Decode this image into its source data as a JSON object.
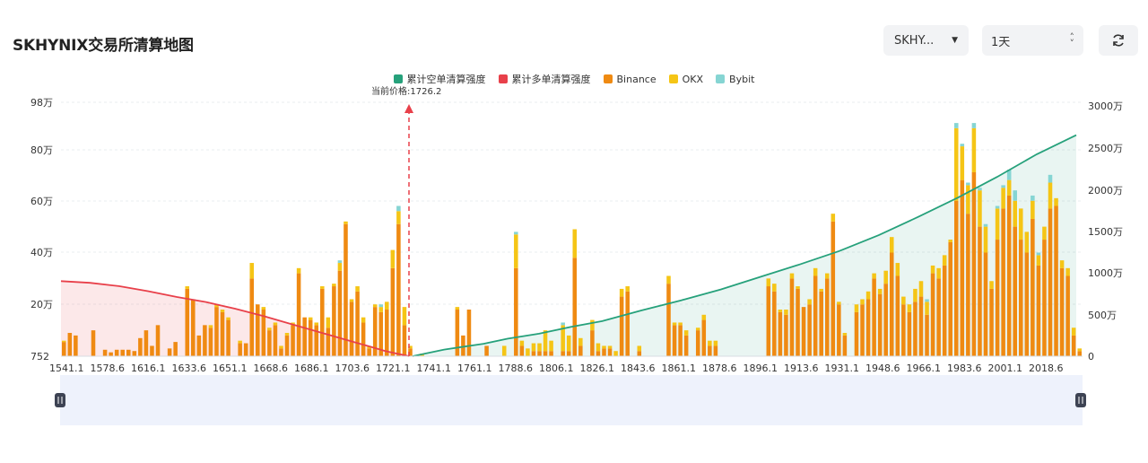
{
  "header": {
    "title": "SKHYNIX交易所清算地图",
    "symbol_select": "SKHY...",
    "interval_select": "1天"
  },
  "colors": {
    "short_cumulative": "#26a17b",
    "long_cumulative": "#e8404a",
    "binance": "#ef8a12",
    "okx": "#f5c516",
    "bybit": "#86d5d3"
  },
  "chart_data": {
    "type": "bar",
    "legend": [
      "累计空单清算强度",
      "累计多单清算强度",
      "Binance",
      "OKX",
      "Bybit"
    ],
    "current_price_label": "当前价格:1726.2",
    "current_price": 1726.2,
    "x_ticks": [
      "1541.1",
      "1578.6",
      "1616.1",
      "1633.6",
      "1651.1",
      "1668.6",
      "1686.1",
      "1703.6",
      "1721.1",
      "1741.1",
      "1761.1",
      "1788.6",
      "1806.1",
      "1826.1",
      "1843.6",
      "1861.1",
      "1878.6",
      "1896.1",
      "1913.6",
      "1931.1",
      "1948.6",
      "1966.1",
      "1983.6",
      "2001.1",
      "2018.6"
    ],
    "y_left_ticks": [
      "752",
      "20万",
      "40万",
      "60万",
      "80万",
      "98万"
    ],
    "y_left_range": [
      752,
      980000
    ],
    "y_right_ticks": [
      "0",
      "500万",
      "1000万",
      "1500万",
      "2000万",
      "2500万",
      "3000万"
    ],
    "y_right_range": [
      0,
      30000000
    ],
    "bars": [
      [
        5.5,
        0.5,
        0
      ],
      [
        9,
        0,
        0
      ],
      [
        8,
        0,
        0
      ],
      [
        0,
        0,
        0
      ],
      [
        0,
        0,
        0
      ],
      [
        10,
        0,
        0
      ],
      [
        0,
        0,
        0
      ],
      [
        2.5,
        0,
        0
      ],
      [
        1.5,
        0,
        0
      ],
      [
        2.5,
        0,
        0
      ],
      [
        2.5,
        0,
        0
      ],
      [
        2.5,
        0,
        0
      ],
      [
        2,
        0,
        0
      ],
      [
        7,
        0,
        0
      ],
      [
        10,
        0,
        0
      ],
      [
        4,
        0,
        0
      ],
      [
        12,
        0,
        0
      ],
      [
        0,
        0,
        0
      ],
      [
        3,
        0,
        0
      ],
      [
        5.5,
        0,
        0
      ],
      [
        0,
        0,
        0
      ],
      [
        26,
        1,
        0
      ],
      [
        22,
        0,
        0
      ],
      [
        8,
        0,
        0
      ],
      [
        12,
        0,
        0
      ],
      [
        11,
        1,
        0
      ],
      [
        19,
        1,
        0
      ],
      [
        17,
        1,
        0
      ],
      [
        14,
        1,
        0
      ],
      [
        0,
        0,
        0
      ],
      [
        5,
        1,
        0
      ],
      [
        5,
        0,
        0
      ],
      [
        30,
        6,
        0
      ],
      [
        20,
        0,
        0
      ],
      [
        18,
        1,
        0
      ],
      [
        10,
        1,
        0
      ],
      [
        12,
        1,
        0
      ],
      [
        3,
        1,
        0
      ],
      [
        8,
        1,
        0
      ],
      [
        12,
        1,
        0
      ],
      [
        32,
        2,
        0
      ],
      [
        15,
        0,
        0
      ],
      [
        14,
        1,
        0
      ],
      [
        12,
        1,
        0
      ],
      [
        26,
        1,
        0
      ],
      [
        11,
        4,
        0
      ],
      [
        27,
        1,
        0
      ],
      [
        33,
        3,
        1
      ],
      [
        51,
        1,
        0
      ],
      [
        21,
        1,
        0
      ],
      [
        25,
        2,
        0
      ],
      [
        13,
        2,
        0
      ],
      [
        3,
        1,
        0
      ],
      [
        19,
        1,
        0
      ],
      [
        17,
        2,
        1
      ],
      [
        18,
        3,
        0
      ],
      [
        34,
        7,
        0
      ],
      [
        51,
        5,
        2
      ],
      [
        12,
        7,
        0
      ],
      [
        3,
        1,
        0
      ],
      [
        0,
        0,
        0
      ],
      [
        0,
        1,
        0
      ],
      [
        0,
        0,
        0
      ],
      [
        0,
        0,
        0
      ],
      [
        0,
        0,
        0
      ],
      [
        0,
        0,
        0
      ],
      [
        0,
        0,
        0
      ],
      [
        18,
        1,
        0
      ],
      [
        8,
        0,
        0
      ],
      [
        18,
        0,
        0
      ],
      [
        0,
        0,
        0
      ],
      [
        0,
        0,
        0
      ],
      [
        4,
        0,
        0
      ],
      [
        0,
        0,
        0
      ],
      [
        0,
        0,
        0
      ],
      [
        0,
        4,
        0
      ],
      [
        0,
        0,
        0
      ],
      [
        34,
        13,
        1
      ],
      [
        4,
        2,
        0
      ],
      [
        0,
        3,
        0
      ],
      [
        2,
        3,
        0
      ],
      [
        2,
        3,
        0
      ],
      [
        2,
        8,
        0
      ],
      [
        2,
        4,
        0
      ],
      [
        0,
        0,
        0
      ],
      [
        2,
        10,
        1
      ],
      [
        2,
        6,
        0
      ],
      [
        38,
        11,
        0
      ],
      [
        4,
        3,
        0
      ],
      [
        0,
        0,
        0
      ],
      [
        10,
        4,
        0
      ],
      [
        2,
        3,
        0
      ],
      [
        3,
        1,
        0
      ],
      [
        3,
        1,
        0
      ],
      [
        0,
        2,
        0
      ],
      [
        23,
        3,
        0
      ],
      [
        25,
        2,
        0
      ],
      [
        0,
        0,
        0
      ],
      [
        2,
        2,
        0
      ],
      [
        0,
        0,
        0
      ],
      [
        0,
        0,
        0
      ],
      [
        0,
        0,
        0
      ],
      [
        0,
        0,
        0
      ],
      [
        28,
        3,
        0
      ],
      [
        12,
        1,
        0
      ],
      [
        12,
        1,
        0
      ],
      [
        8,
        2,
        0
      ],
      [
        0,
        0,
        0
      ],
      [
        10,
        1,
        0
      ],
      [
        14,
        2,
        0
      ],
      [
        4,
        2,
        0
      ],
      [
        4,
        2,
        0
      ],
      [
        0,
        0,
        0
      ],
      [
        0,
        0,
        0
      ],
      [
        0,
        0,
        0
      ],
      [
        0,
        0,
        0
      ],
      [
        0,
        0,
        0
      ],
      [
        0,
        0,
        0
      ],
      [
        0,
        0,
        0
      ],
      [
        0,
        0,
        0
      ],
      [
        27,
        3,
        0
      ],
      [
        25,
        3,
        0
      ],
      [
        17,
        1,
        0
      ],
      [
        16,
        2,
        0
      ],
      [
        30,
        2,
        0
      ],
      [
        26,
        1,
        0
      ],
      [
        19,
        0,
        0
      ],
      [
        20,
        2,
        0
      ],
      [
        31,
        3,
        0
      ],
      [
        25,
        1,
        0
      ],
      [
        30,
        2,
        0
      ],
      [
        52,
        3,
        0
      ],
      [
        20,
        1,
        0
      ],
      [
        8,
        1,
        0
      ],
      [
        0,
        0,
        0
      ],
      [
        17,
        3,
        0
      ],
      [
        20,
        2,
        0
      ],
      [
        22,
        3,
        0
      ],
      [
        30,
        2,
        0
      ],
      [
        24,
        2,
        0
      ],
      [
        28,
        5,
        0
      ],
      [
        40,
        6,
        0
      ],
      [
        31,
        5,
        0
      ],
      [
        20,
        3,
        0
      ],
      [
        17,
        3,
        0
      ],
      [
        21,
        5,
        0
      ],
      [
        23,
        6,
        0
      ],
      [
        16,
        5,
        1
      ],
      [
        32,
        3,
        0
      ],
      [
        30,
        4,
        0
      ],
      [
        35,
        4,
        0
      ],
      [
        44,
        1,
        0
      ],
      [
        60,
        28,
        2
      ],
      [
        68,
        13,
        1
      ],
      [
        55,
        11,
        1
      ],
      [
        71,
        17,
        2
      ],
      [
        50,
        14,
        1
      ],
      [
        40,
        10,
        1
      ],
      [
        26,
        3,
        0
      ],
      [
        45,
        12,
        1
      ],
      [
        57,
        8,
        1
      ],
      [
        62,
        6,
        4
      ],
      [
        50,
        10,
        4
      ],
      [
        45,
        12,
        0
      ],
      [
        40,
        8,
        0
      ],
      [
        53,
        7,
        2
      ],
      [
        35,
        4,
        1
      ],
      [
        45,
        5,
        0
      ],
      [
        57,
        10,
        3
      ],
      [
        58,
        3,
        0
      ],
      [
        34,
        3,
        0
      ],
      [
        31,
        3,
        0
      ],
      [
        8,
        3,
        0
      ],
      [
        2,
        1,
        0
      ]
    ],
    "long_cumulative_curve": [
      [
        0,
        9000000
      ],
      [
        0.05,
        8800000
      ],
      [
        0.1,
        8400000
      ],
      [
        0.15,
        7800000
      ],
      [
        0.2,
        7100000
      ],
      [
        0.25,
        6500000
      ],
      [
        0.3,
        5700000
      ],
      [
        0.35,
        4800000
      ],
      [
        0.4,
        3800000
      ],
      [
        0.45,
        2800000
      ],
      [
        0.5,
        1800000
      ],
      [
        0.53,
        1200000
      ],
      [
        0.56,
        600000
      ],
      [
        0.6,
        0
      ]
    ],
    "short_cumulative_curve": [
      [
        0.66,
        0
      ],
      [
        0.7,
        800000
      ],
      [
        0.75,
        1500000
      ],
      [
        0.78,
        2100000
      ],
      [
        0.82,
        2700000
      ],
      [
        0.86,
        3500000
      ],
      [
        0.9,
        4200000
      ],
      [
        0.95,
        5500000
      ],
      [
        1.0,
        6700000
      ],
      [
        1.05,
        8000000
      ],
      [
        1.1,
        9500000
      ],
      [
        1.15,
        11000000
      ],
      [
        1.2,
        12600000
      ],
      [
        1.25,
        14500000
      ],
      [
        1.3,
        16700000
      ],
      [
        1.35,
        19000000
      ],
      [
        1.4,
        21500000
      ],
      [
        1.45,
        24200000
      ],
      [
        1.5,
        26500000
      ]
    ]
  }
}
